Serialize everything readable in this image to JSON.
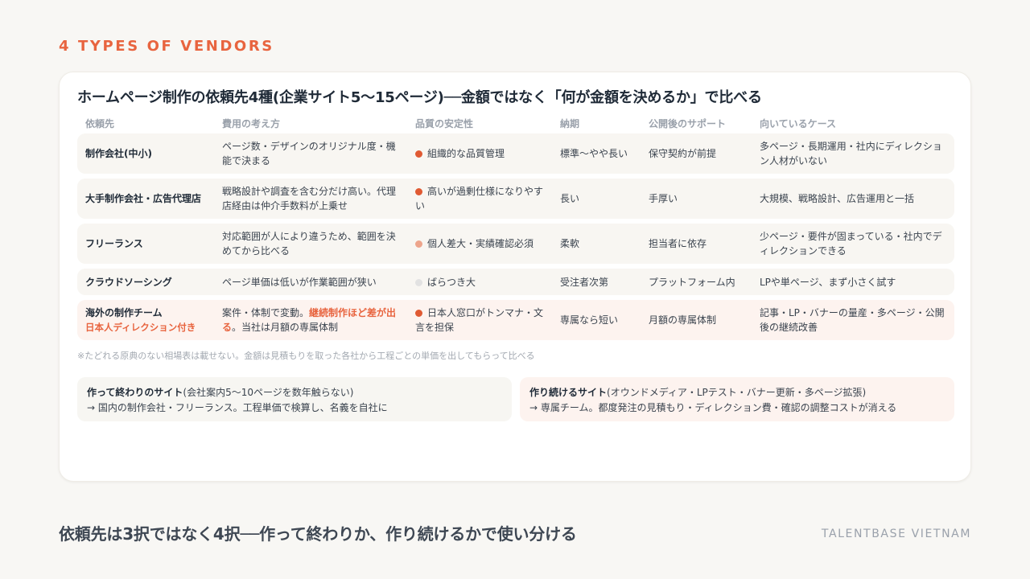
{
  "eyebrow": "4 TYPES OF VENDORS",
  "title": "ホームページ制作の依頼先4種(企業サイト5〜15ページ)──金額ではなく「何が金額を決めるか」で比べる",
  "headers": [
    "依頼先",
    "費用の考え方",
    "品質の安定性",
    "納期",
    "公開後のサポート",
    "向いているケース"
  ],
  "colors": {
    "accent": "#e8643f",
    "dot_strong": "#e05a33",
    "dot_light": "#eda58c",
    "dot_gray": "#e2e2e2"
  },
  "rows": [
    {
      "vendor": "制作会社(中小)",
      "cost": "ページ数・デザインのオリジナル度・機能で決まる",
      "quality": "組織的な品質管理",
      "quality_dot": "dot_strong",
      "delivery": "標準〜やや長い",
      "support": "保守契約が前提",
      "fit": "多ページ・長期運用・社内にディレクション人材がいない"
    },
    {
      "vendor": "大手制作会社・広告代理店",
      "cost": "戦略設計や調査を含む分だけ高い。代理店経由は仲介手数料が上乗せ",
      "quality": "高いが過剰仕様になりやすい",
      "quality_dot": "dot_strong",
      "delivery": "長い",
      "support": "手厚い",
      "fit": "大規模、戦略設計、広告運用と一括"
    },
    {
      "vendor": "フリーランス",
      "cost": "対応範囲が人により違うため、範囲を決めてから比べる",
      "quality": "個人差大・実績確認必須",
      "quality_dot": "dot_light",
      "delivery": "柔軟",
      "support": "担当者に依存",
      "fit": "少ページ・要件が固まっている・社内でディレクションできる"
    },
    {
      "vendor": "クラウドソーシング",
      "cost": "ページ単価は低いが作業範囲が狭い",
      "quality": "ばらつき大",
      "quality_dot": "dot_gray",
      "delivery": "受注者次第",
      "support": "プラットフォーム内",
      "fit": "LPや単ページ、まず小さく試す"
    },
    {
      "vendor": "海外の制作チーム",
      "vendor_sub": "日本人ディレクション付き",
      "cost_pre": "案件・体制で変動。",
      "cost_accent": "継続制作ほど差が出る",
      "cost_post": "。当社は月額の専属体制",
      "quality": "日本人窓口がトンマナ・文言を担保",
      "quality_dot": "dot_strong",
      "delivery": "専属なら短い",
      "support": "月額の専属体制",
      "fit": "記事・LP・バナーの量産・多ページ・公開後の継続改善"
    }
  ],
  "note": "※たどれる原典のない相場表は載せない。金額は見積もりを取った各社から工程ごとの単価を出してもらって比べる",
  "boxes": {
    "left": {
      "title": "作って終わりのサイト",
      "title_note": "(会社案内5〜10ページを数年触らない)",
      "body": "→ 国内の制作会社・フリーランス。工程単価で検算し、名義を自社に"
    },
    "right": {
      "title": "作り続けるサイト",
      "title_note": "(オウンドメディア・LPテスト・バナー更新・多ページ拡張)",
      "body": "→ 専属チーム。都度発注の見積もり・ディレクション費・確認の調整コストが消える"
    }
  },
  "footer_title": "依頼先は3択ではなく4択──作って終わりか、作り続けるかで使い分ける",
  "brand": "TALENTBASE VIETNAM"
}
